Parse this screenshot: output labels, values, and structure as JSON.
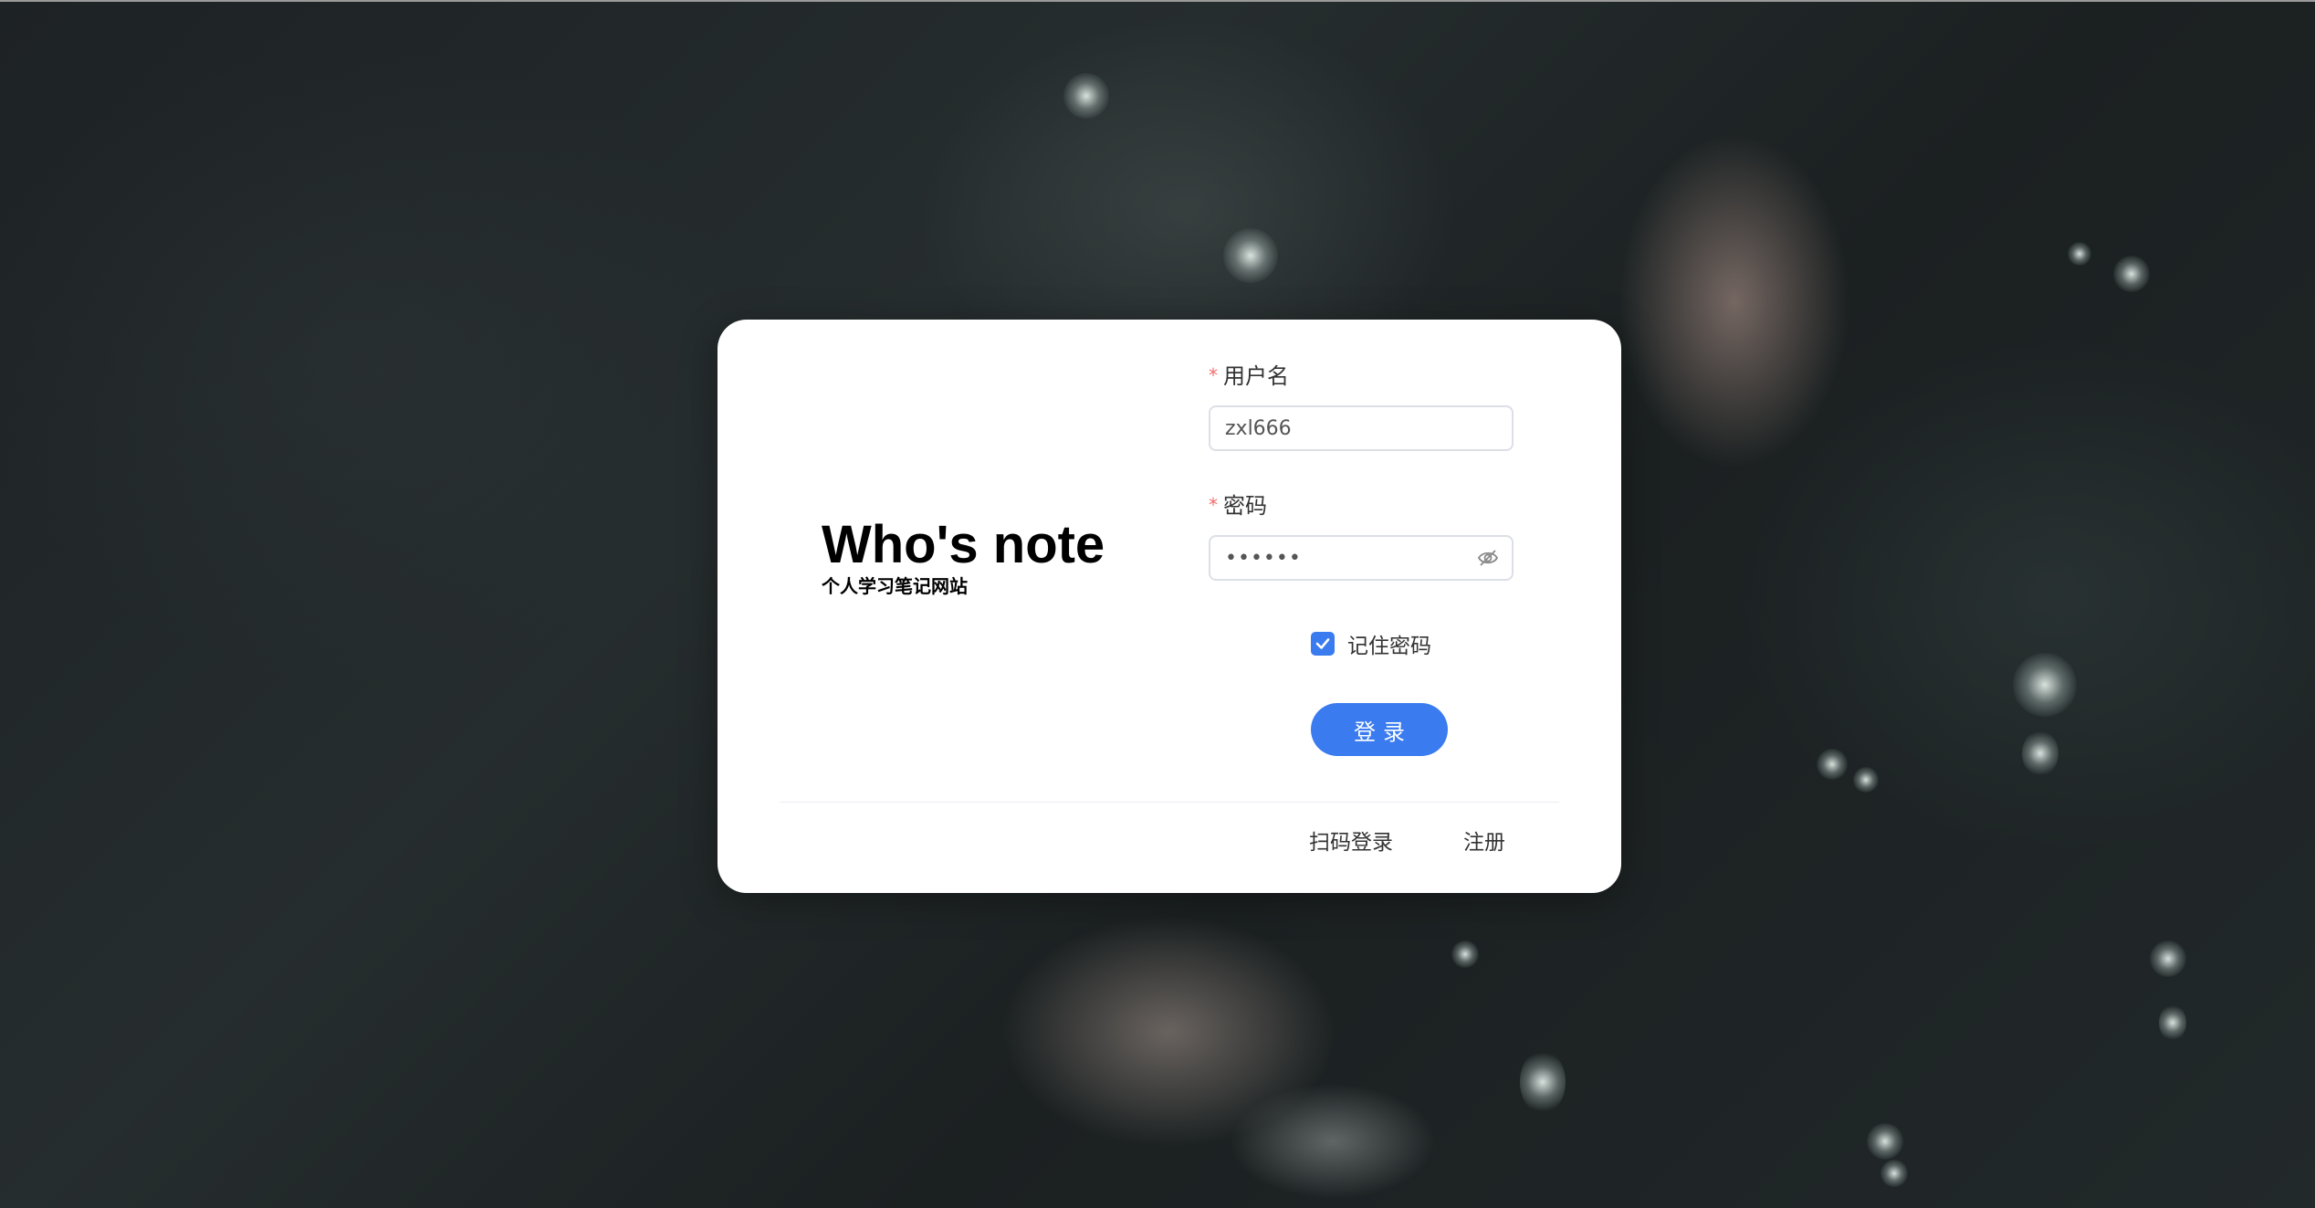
{
  "brand": {
    "title": "Who's note",
    "subtitle": "个人学习笔记网站"
  },
  "form": {
    "username": {
      "required_mark": "*",
      "label": "用户名",
      "value": "zxl666"
    },
    "password": {
      "required_mark": "*",
      "label": "密码",
      "value": "••••••",
      "toggle_icon": "eye-off-icon"
    },
    "remember": {
      "label": "记住密码",
      "checked": true
    },
    "login_button": "登录"
  },
  "footer": {
    "qr_login": "扫码登录",
    "register": "注册"
  },
  "colors": {
    "primary": "#3a7bf0",
    "required": "#f56c6c",
    "card": "#ffffff"
  }
}
